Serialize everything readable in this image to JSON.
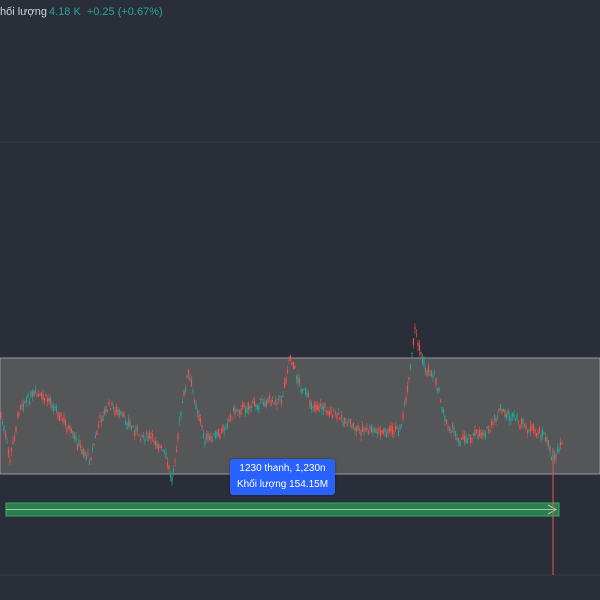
{
  "legend": {
    "label": "hối lượng",
    "value": "4.18 K",
    "change": "+0.25 (+0.67%)"
  },
  "measure_tooltip": {
    "line1": "1230 thanh, 1,230n",
    "line2": "Khối lượng 154.15M"
  },
  "colors": {
    "background": "#2a2e39",
    "up_candle": "#26a69a",
    "down_candle": "#ef5350",
    "range_fill": "#5d5d5d",
    "measure_bar": "#2e7d4f",
    "tooltip_bg": "#2962ff",
    "legend_value": "#26a69a"
  }
}
